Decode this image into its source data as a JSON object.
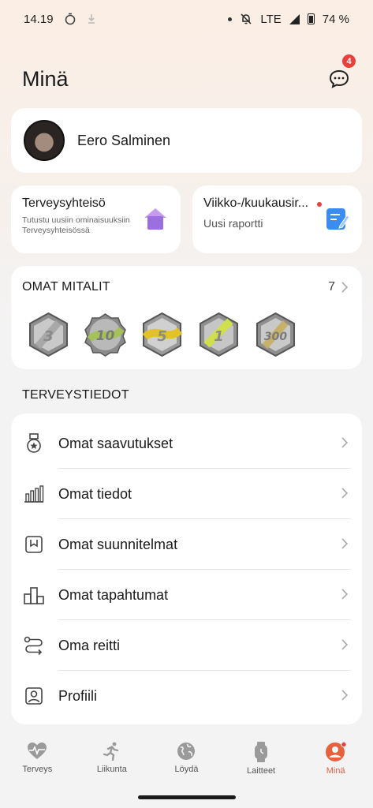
{
  "status_bar": {
    "time": "14.19",
    "network": "LTE",
    "battery": "74 %"
  },
  "header": {
    "title": "Minä",
    "messages_badge": "4"
  },
  "profile": {
    "name": "Eero Salminen"
  },
  "community_card": {
    "title": "Terveysyhteisö",
    "subtitle": "Tutustu uusiin ominaisuuksiin Terveysyhteisössä"
  },
  "report_card": {
    "title": "Viikko-/kuukausir...",
    "subtitle": "Uusi raportti"
  },
  "medals": {
    "title": "OMAT MITALIT",
    "count": "7",
    "items": [
      "3",
      "10",
      "5",
      "1",
      "300"
    ]
  },
  "health_section": {
    "title": "TERVEYSTIEDOT"
  },
  "menu": [
    {
      "label": "Omat saavutukset",
      "icon": "medal-icon"
    },
    {
      "label": "Omat tiedot",
      "icon": "bar-chart-icon"
    },
    {
      "label": "Omat suunnitelmat",
      "icon": "plan-icon"
    },
    {
      "label": "Omat tapahtumat",
      "icon": "podium-icon"
    },
    {
      "label": "Oma reitti",
      "icon": "route-icon"
    },
    {
      "label": "Profiili",
      "icon": "profile-icon"
    }
  ],
  "nav": [
    {
      "label": "Terveys"
    },
    {
      "label": "Liikunta"
    },
    {
      "label": "Löydä"
    },
    {
      "label": "Laitteet"
    },
    {
      "label": "Minä"
    }
  ],
  "colors": {
    "accent": "#e8603c",
    "badge": "#e8403a",
    "community_icon": "#9b6fe0",
    "report_icon": "#3b8cf0"
  }
}
